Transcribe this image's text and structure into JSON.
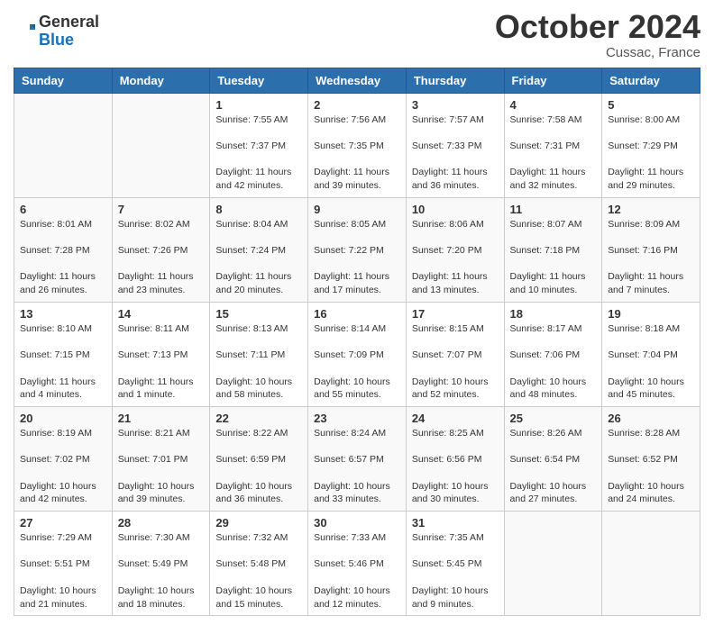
{
  "header": {
    "logo": {
      "line1": "General",
      "line2": "Blue"
    },
    "title": "October 2024",
    "location": "Cussac, France"
  },
  "calendar": {
    "days_of_week": [
      "Sunday",
      "Monday",
      "Tuesday",
      "Wednesday",
      "Thursday",
      "Friday",
      "Saturday"
    ],
    "weeks": [
      [
        {
          "day": "",
          "content": ""
        },
        {
          "day": "",
          "content": ""
        },
        {
          "day": "1",
          "content": "Sunrise: 7:55 AM\nSunset: 7:37 PM\nDaylight: 11 hours and 42 minutes."
        },
        {
          "day": "2",
          "content": "Sunrise: 7:56 AM\nSunset: 7:35 PM\nDaylight: 11 hours and 39 minutes."
        },
        {
          "day": "3",
          "content": "Sunrise: 7:57 AM\nSunset: 7:33 PM\nDaylight: 11 hours and 36 minutes."
        },
        {
          "day": "4",
          "content": "Sunrise: 7:58 AM\nSunset: 7:31 PM\nDaylight: 11 hours and 32 minutes."
        },
        {
          "day": "5",
          "content": "Sunrise: 8:00 AM\nSunset: 7:29 PM\nDaylight: 11 hours and 29 minutes."
        }
      ],
      [
        {
          "day": "6",
          "content": "Sunrise: 8:01 AM\nSunset: 7:28 PM\nDaylight: 11 hours and 26 minutes."
        },
        {
          "day": "7",
          "content": "Sunrise: 8:02 AM\nSunset: 7:26 PM\nDaylight: 11 hours and 23 minutes."
        },
        {
          "day": "8",
          "content": "Sunrise: 8:04 AM\nSunset: 7:24 PM\nDaylight: 11 hours and 20 minutes."
        },
        {
          "day": "9",
          "content": "Sunrise: 8:05 AM\nSunset: 7:22 PM\nDaylight: 11 hours and 17 minutes."
        },
        {
          "day": "10",
          "content": "Sunrise: 8:06 AM\nSunset: 7:20 PM\nDaylight: 11 hours and 13 minutes."
        },
        {
          "day": "11",
          "content": "Sunrise: 8:07 AM\nSunset: 7:18 PM\nDaylight: 11 hours and 10 minutes."
        },
        {
          "day": "12",
          "content": "Sunrise: 8:09 AM\nSunset: 7:16 PM\nDaylight: 11 hours and 7 minutes."
        }
      ],
      [
        {
          "day": "13",
          "content": "Sunrise: 8:10 AM\nSunset: 7:15 PM\nDaylight: 11 hours and 4 minutes."
        },
        {
          "day": "14",
          "content": "Sunrise: 8:11 AM\nSunset: 7:13 PM\nDaylight: 11 hours and 1 minute."
        },
        {
          "day": "15",
          "content": "Sunrise: 8:13 AM\nSunset: 7:11 PM\nDaylight: 10 hours and 58 minutes."
        },
        {
          "day": "16",
          "content": "Sunrise: 8:14 AM\nSunset: 7:09 PM\nDaylight: 10 hours and 55 minutes."
        },
        {
          "day": "17",
          "content": "Sunrise: 8:15 AM\nSunset: 7:07 PM\nDaylight: 10 hours and 52 minutes."
        },
        {
          "day": "18",
          "content": "Sunrise: 8:17 AM\nSunset: 7:06 PM\nDaylight: 10 hours and 48 minutes."
        },
        {
          "day": "19",
          "content": "Sunrise: 8:18 AM\nSunset: 7:04 PM\nDaylight: 10 hours and 45 minutes."
        }
      ],
      [
        {
          "day": "20",
          "content": "Sunrise: 8:19 AM\nSunset: 7:02 PM\nDaylight: 10 hours and 42 minutes."
        },
        {
          "day": "21",
          "content": "Sunrise: 8:21 AM\nSunset: 7:01 PM\nDaylight: 10 hours and 39 minutes."
        },
        {
          "day": "22",
          "content": "Sunrise: 8:22 AM\nSunset: 6:59 PM\nDaylight: 10 hours and 36 minutes."
        },
        {
          "day": "23",
          "content": "Sunrise: 8:24 AM\nSunset: 6:57 PM\nDaylight: 10 hours and 33 minutes."
        },
        {
          "day": "24",
          "content": "Sunrise: 8:25 AM\nSunset: 6:56 PM\nDaylight: 10 hours and 30 minutes."
        },
        {
          "day": "25",
          "content": "Sunrise: 8:26 AM\nSunset: 6:54 PM\nDaylight: 10 hours and 27 minutes."
        },
        {
          "day": "26",
          "content": "Sunrise: 8:28 AM\nSunset: 6:52 PM\nDaylight: 10 hours and 24 minutes."
        }
      ],
      [
        {
          "day": "27",
          "content": "Sunrise: 7:29 AM\nSunset: 5:51 PM\nDaylight: 10 hours and 21 minutes."
        },
        {
          "day": "28",
          "content": "Sunrise: 7:30 AM\nSunset: 5:49 PM\nDaylight: 10 hours and 18 minutes."
        },
        {
          "day": "29",
          "content": "Sunrise: 7:32 AM\nSunset: 5:48 PM\nDaylight: 10 hours and 15 minutes."
        },
        {
          "day": "30",
          "content": "Sunrise: 7:33 AM\nSunset: 5:46 PM\nDaylight: 10 hours and 12 minutes."
        },
        {
          "day": "31",
          "content": "Sunrise: 7:35 AM\nSunset: 5:45 PM\nDaylight: 10 hours and 9 minutes."
        },
        {
          "day": "",
          "content": ""
        },
        {
          "day": "",
          "content": ""
        }
      ]
    ]
  }
}
